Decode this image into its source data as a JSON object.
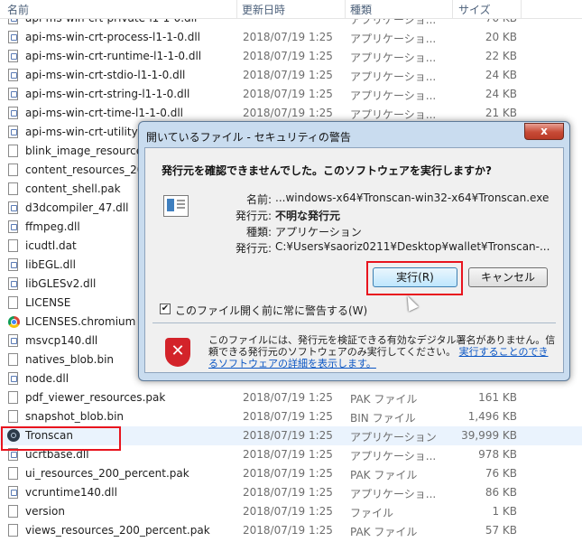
{
  "explorer": {
    "columns": {
      "name": "名前",
      "date": "更新日時",
      "type": "種類",
      "size": "サイズ"
    },
    "files": [
      {
        "name": "api-ms-win-crt-private-l1-1-0.dll",
        "date": "",
        "type": "アプリケーショ...",
        "size": "70 KB",
        "icon": "dll-file-icon"
      },
      {
        "name": "api-ms-win-crt-process-l1-1-0.dll",
        "date": "2018/07/19 1:25",
        "type": "アプリケーショ...",
        "size": "20 KB",
        "icon": "dll-file-icon"
      },
      {
        "name": "api-ms-win-crt-runtime-l1-1-0.dll",
        "date": "2018/07/19 1:25",
        "type": "アプリケーショ...",
        "size": "22 KB",
        "icon": "dll-file-icon"
      },
      {
        "name": "api-ms-win-crt-stdio-l1-1-0.dll",
        "date": "2018/07/19 1:25",
        "type": "アプリケーショ...",
        "size": "24 KB",
        "icon": "dll-file-icon"
      },
      {
        "name": "api-ms-win-crt-string-l1-1-0.dll",
        "date": "2018/07/19 1:25",
        "type": "アプリケーショ...",
        "size": "24 KB",
        "icon": "dll-file-icon"
      },
      {
        "name": "api-ms-win-crt-time-l1-1-0.dll",
        "date": "2018/07/19 1:25",
        "type": "アプリケーショ...",
        "size": "21 KB",
        "icon": "dll-file-icon"
      },
      {
        "name": "api-ms-win-crt-utility",
        "date": "",
        "type": "",
        "size": "",
        "icon": "dll-file-icon"
      },
      {
        "name": "blink_image_resource",
        "date": "",
        "type": "",
        "size": "",
        "icon": "file-icon"
      },
      {
        "name": "content_resources_20",
        "date": "",
        "type": "",
        "size": "",
        "icon": "file-icon"
      },
      {
        "name": "content_shell.pak",
        "date": "",
        "type": "",
        "size": "",
        "icon": "file-icon"
      },
      {
        "name": "d3dcompiler_47.dll",
        "date": "",
        "type": "",
        "size": "",
        "icon": "dll-file-icon"
      },
      {
        "name": "ffmpeg.dll",
        "date": "",
        "type": "",
        "size": "",
        "icon": "dll-file-icon"
      },
      {
        "name": "icudtl.dat",
        "date": "",
        "type": "",
        "size": "",
        "icon": "file-icon"
      },
      {
        "name": "libEGL.dll",
        "date": "",
        "type": "",
        "size": "",
        "icon": "dll-file-icon"
      },
      {
        "name": "libGLESv2.dll",
        "date": "",
        "type": "",
        "size": "",
        "icon": "dll-file-icon"
      },
      {
        "name": "LICENSE",
        "date": "",
        "type": "",
        "size": "",
        "icon": "file-icon"
      },
      {
        "name": "LICENSES.chromium",
        "date": "",
        "type": "",
        "size": "",
        "icon": "chrome-icon"
      },
      {
        "name": "msvcp140.dll",
        "date": "",
        "type": "",
        "size": "",
        "icon": "dll-file-icon"
      },
      {
        "name": "natives_blob.bin",
        "date": "",
        "type": "",
        "size": "",
        "icon": "file-icon"
      },
      {
        "name": "node.dll",
        "date": "",
        "type": "",
        "size": "",
        "icon": "dll-file-icon"
      },
      {
        "name": "pdf_viewer_resources.pak",
        "date": "2018/07/19 1:25",
        "type": "PAK ファイル",
        "size": "161 KB",
        "icon": "file-icon"
      },
      {
        "name": "snapshot_blob.bin",
        "date": "2018/07/19 1:25",
        "type": "BIN ファイル",
        "size": "1,496 KB",
        "icon": "file-icon"
      },
      {
        "name": "Tronscan",
        "date": "2018/07/19 1:25",
        "type": "アプリケーション",
        "size": "39,999 KB",
        "icon": "tronscan-app-icon"
      },
      {
        "name": "ucrtbase.dll",
        "date": "2018/07/19 1:25",
        "type": "アプリケーショ...",
        "size": "978 KB",
        "icon": "dll-file-icon"
      },
      {
        "name": "ui_resources_200_percent.pak",
        "date": "2018/07/19 1:25",
        "type": "PAK ファイル",
        "size": "76 KB",
        "icon": "file-icon"
      },
      {
        "name": "vcruntime140.dll",
        "date": "2018/07/19 1:25",
        "type": "アプリケーショ...",
        "size": "86 KB",
        "icon": "dll-file-icon"
      },
      {
        "name": "version",
        "date": "2018/07/19 1:25",
        "type": "ファイル",
        "size": "1 KB",
        "icon": "file-icon"
      },
      {
        "name": "views_resources_200_percent.pak",
        "date": "2018/07/19 1:25",
        "type": "PAK ファイル",
        "size": "57 KB",
        "icon": "file-icon"
      }
    ]
  },
  "dialog": {
    "title": "開いているファイル - セキュリティの警告",
    "close_label": "x",
    "heading": "発行元を確認できませんでした。このソフトウェアを実行しますか?",
    "fields": [
      {
        "label": "名前:",
        "value": "...windows-x64¥Tronscan-win32-x64¥Tronscan.exe",
        "bold": false
      },
      {
        "label": "発行元:",
        "value": "不明な発行元",
        "bold": true
      },
      {
        "label": "種類:",
        "value": "アプリケーション",
        "bold": false
      },
      {
        "label": "発行元:",
        "value": "C:¥Users¥saoriz0211¥Desktop¥wallet¥Tronscan-...",
        "bold": false
      }
    ],
    "run_button": "実行(R)",
    "cancel_button": "キャンセル",
    "checkbox_label": "このファイル開く前に常に警告する(W)",
    "checkbox_checked": true,
    "warning_text": "このファイルには、発行元を検証できる有効なデジタル署名がありません。信頼できる発行元のソフトウェアのみ実行してください。",
    "warning_link": "実行することのできるソフトウェアの詳細を表示します。",
    "shield_icon": "shield-x-icon"
  },
  "colors": {
    "highlight": "#e8141e",
    "dialog_frame": "#c9dcef",
    "link": "#0b56c4"
  }
}
